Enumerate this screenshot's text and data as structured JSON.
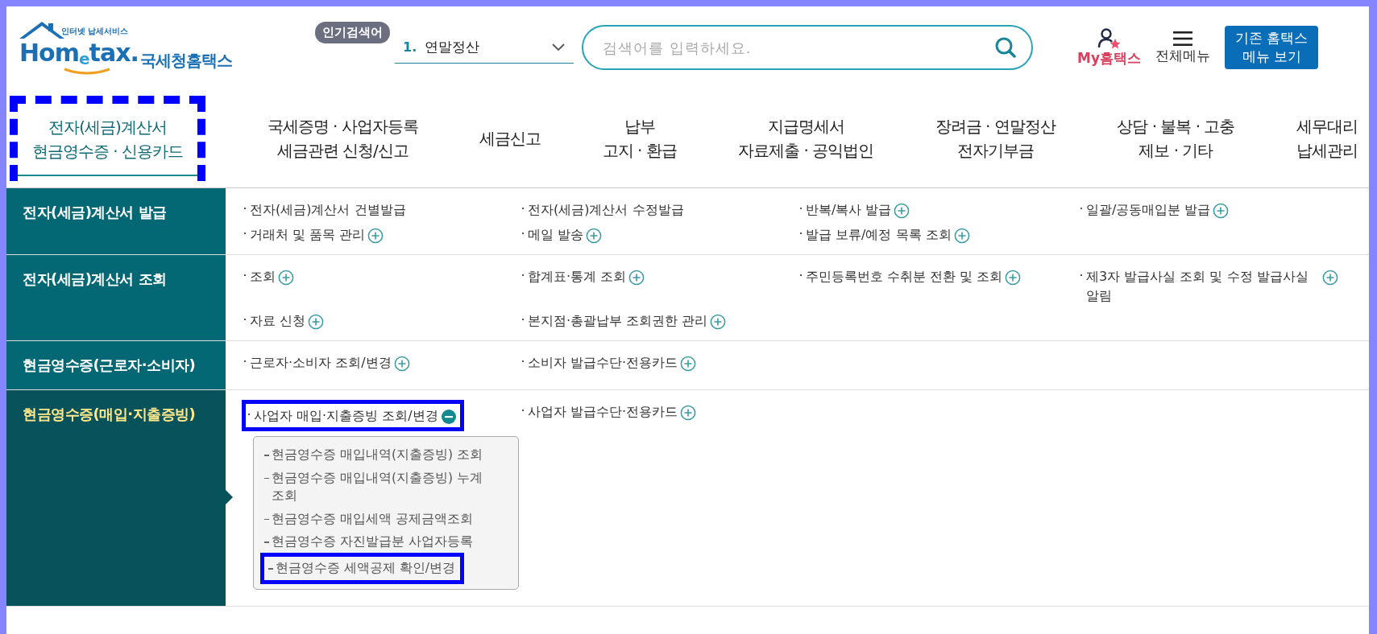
{
  "header": {
    "logo": {
      "tagline": "인터넷 납세서비스",
      "wordmark": "Hom$_{e}$tax.",
      "name": "국세청홈택스"
    },
    "popular": {
      "badge": "인기검색어",
      "rank": "1.",
      "keyword": "연말정산"
    },
    "search": {
      "placeholder": "검색어를 입력하세요."
    },
    "my_link": "My홈택스",
    "all_menu": "전체메뉴",
    "classic_button": "기존 홈택스\n메뉴 보기"
  },
  "nav_tabs": [
    {
      "label": "전자(세금)계산서\n현금영수증 · 신용카드",
      "selected": true,
      "highlighted": true
    },
    {
      "label": "국세증명 · 사업자등록\n세금관련 신청/신고",
      "selected": false,
      "highlighted": false
    },
    {
      "label": "세금신고",
      "selected": false,
      "highlighted": false
    },
    {
      "label": "납부\n고지 · 환급",
      "selected": false,
      "highlighted": false
    },
    {
      "label": "지급명세서\n자료제출 · 공익법인",
      "selected": false,
      "highlighted": false
    },
    {
      "label": "장려금 · 연말정산\n전자기부금",
      "selected": false,
      "highlighted": false
    },
    {
      "label": "상담 · 불복 · 고충\n제보 · 기타",
      "selected": false,
      "highlighted": false
    },
    {
      "label": "세무대리\n납세관리",
      "selected": false,
      "highlighted": false
    }
  ],
  "menu_rows": [
    {
      "title": "전자(세금)계산서 발급",
      "selected": false,
      "items": [
        {
          "label": "전자(세금)계산서 건별발급"
        },
        {
          "label": "전자(세금)계산서 수정발급"
        },
        {
          "label": "반복/복사 발급",
          "expanded": false
        },
        {
          "label": "일괄/공동매입분 발급",
          "expanded": false
        },
        {
          "label": "거래처 및 품목 관리",
          "expanded": false
        },
        {
          "label": "메일 발송",
          "expanded": false
        },
        {
          "label": "발급 보류/예정 목록 조회",
          "expanded": false
        }
      ]
    },
    {
      "title": "전자(세금)계산서 조회",
      "selected": false,
      "items": [
        {
          "label": "조회",
          "expanded": false
        },
        {
          "label": "합계표·통계 조회",
          "expanded": false
        },
        {
          "label": "주민등록번호 수취분 전환 및 조회",
          "expanded": false
        },
        {
          "label": "제3자 발급사실 조회 및 수정 발급사실 알림",
          "expanded": false
        },
        {
          "label": "자료 신청",
          "expanded": false
        },
        {
          "label": "본지점·총괄납부 조회권한 관리",
          "expanded": false
        }
      ]
    },
    {
      "title": "현금영수증(근로자·소비자)",
      "selected": false,
      "items": [
        {
          "label": "근로자·소비자 조회/변경",
          "expanded": false
        },
        {
          "label": "소비자 발급수단·전용카드",
          "expanded": false
        }
      ]
    },
    {
      "title": "현금영수증(매입·지출증빙)",
      "selected": true,
      "items": [
        {
          "label": "사업자 매입·지출증빙 조회/변경",
          "expanded": true,
          "highlighted": true,
          "children": [
            {
              "label": "현금영수증 매입내역(지출증빙) 조회",
              "highlighted": false
            },
            {
              "label": "현금영수증 매입내역(지출증빙) 누계 조회",
              "highlighted": false
            },
            {
              "label": "현금영수증 매입세액 공제금액조회",
              "highlighted": false
            },
            {
              "label": "현금영수증 자진발급분 사업자등록",
              "highlighted": false
            },
            {
              "label": "현금영수증 세액공제 확인/변경",
              "highlighted": true
            }
          ]
        },
        {
          "label": "사업자 발급수단·전용카드",
          "expanded": false,
          "highlighted": false
        }
      ]
    }
  ]
}
